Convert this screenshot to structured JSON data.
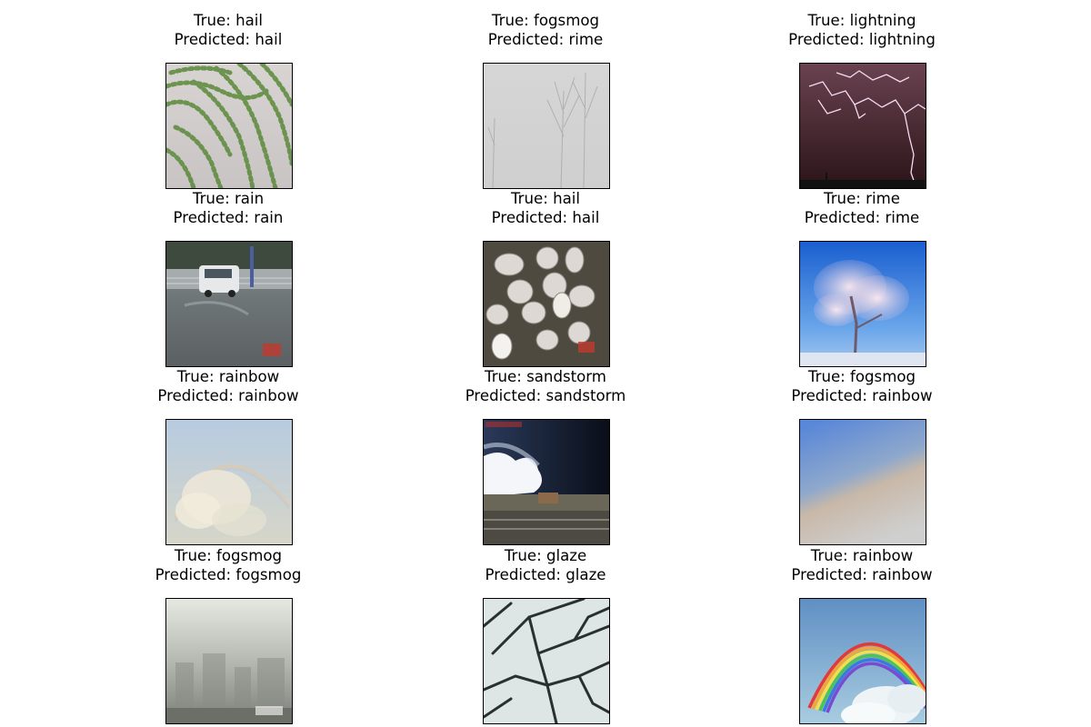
{
  "panels": [
    {
      "true_label": "True: hail",
      "pred_label": "Predicted: hail",
      "scene": "hail-field"
    },
    {
      "true_label": "True: fogsmog",
      "pred_label": "Predicted: rime",
      "scene": "foggy-trees"
    },
    {
      "true_label": "True: lightning",
      "pred_label": "Predicted: lightning",
      "scene": "lightning-sky"
    },
    {
      "true_label": "True: rain",
      "pred_label": "Predicted: rain",
      "scene": "rainy-street-van"
    },
    {
      "true_label": "True: hail",
      "pred_label": "Predicted: hail",
      "scene": "hailstones-closeup"
    },
    {
      "true_label": "True: rime",
      "pred_label": "Predicted: rime",
      "scene": "frosted-tree"
    },
    {
      "true_label": "True: rainbow",
      "pred_label": "Predicted: rainbow",
      "scene": "hazy-rainbow"
    },
    {
      "true_label": "True: sandstorm",
      "pred_label": "Predicted: sandstorm",
      "scene": "dark-storm-cloud"
    },
    {
      "true_label": "True: fogsmog",
      "pred_label": "Predicted: rainbow",
      "scene": "hazy-sky-gradient"
    },
    {
      "true_label": "True: fogsmog",
      "pred_label": "Predicted: fogsmog",
      "scene": "smoggy-city"
    },
    {
      "true_label": "True: glaze",
      "pred_label": "Predicted: glaze",
      "scene": "iced-branches"
    },
    {
      "true_label": "True: rainbow",
      "pred_label": "Predicted: rainbow",
      "scene": "rainbow-over-clouds"
    }
  ]
}
